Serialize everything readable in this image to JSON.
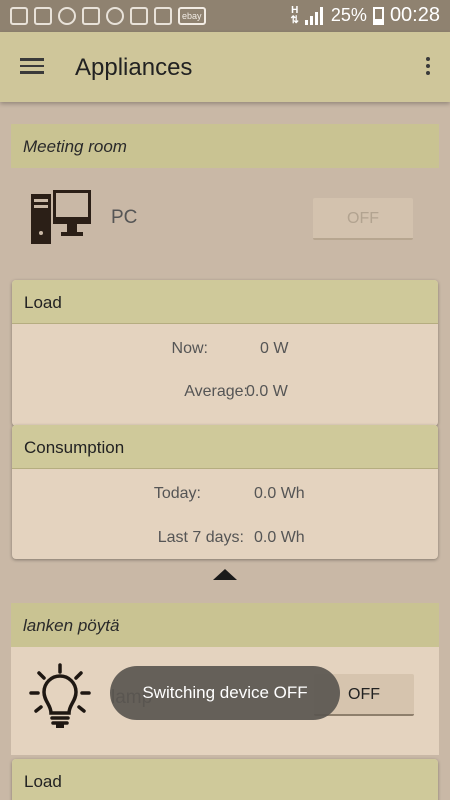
{
  "status_bar": {
    "battery": "25%",
    "time": "00:28",
    "network_label": "H",
    "icons": [
      "chat-icon",
      "facebook-icon",
      "hangouts-icon",
      "gallery-icon",
      "pause-icon",
      "rss-icon",
      "instagram-icon",
      "ebay-icon"
    ],
    "ebay_text": "ebay"
  },
  "app_bar": {
    "title": "Appliances"
  },
  "rooms": [
    {
      "name": "Meeting room",
      "device": {
        "name": "PC",
        "toggle_label": "OFF",
        "icon": "desktop-computer-icon"
      },
      "load": {
        "header": "Load",
        "now_label": "Now:",
        "now_value": "0 W",
        "average_label": "Average:",
        "average_value": "0.0 W"
      },
      "consumption": {
        "header": "Consumption",
        "today_label": "Today:",
        "today_value": "0.0 Wh",
        "week_label": "Last 7 days:",
        "week_value": "0.0 Wh"
      }
    },
    {
      "name": "lanken pöytä",
      "device": {
        "name": "lamp",
        "toggle_label": "OFF",
        "icon": "lightbulb-icon"
      },
      "load": {
        "header": "Load"
      }
    }
  ],
  "toast": {
    "message": "Switching device OFF"
  },
  "colors": {
    "app_bar": "#cfc69a",
    "background": "#c9b8a6",
    "card": "#e4d3bf",
    "status_bar": "#8f8270"
  }
}
